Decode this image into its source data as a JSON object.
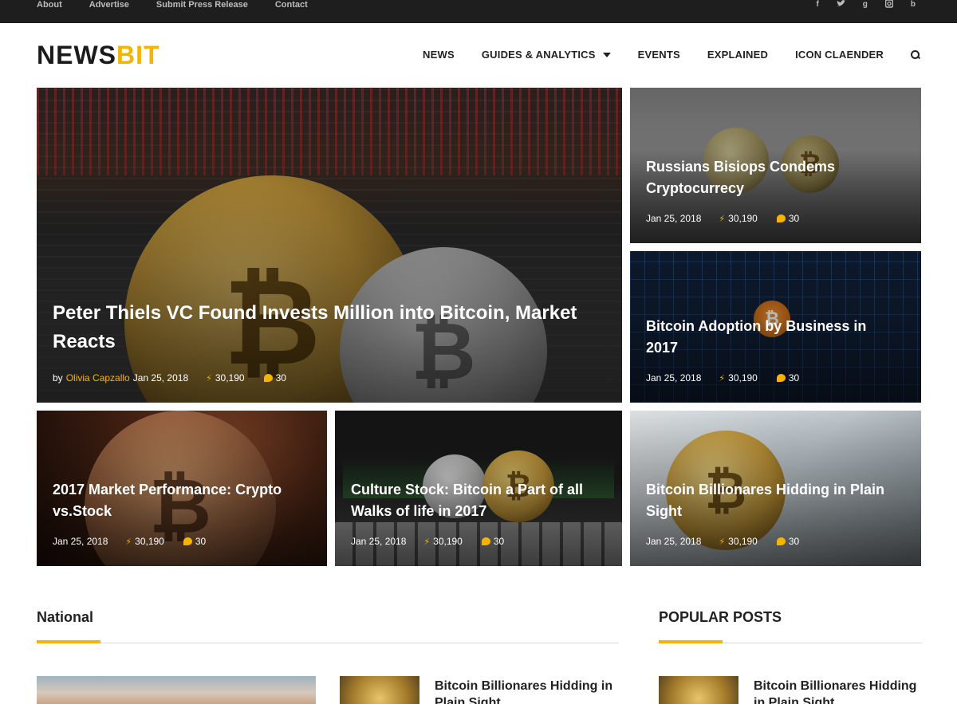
{
  "topbar": {
    "links": [
      "About",
      "Advertise",
      "Submit Press Release",
      "Contact"
    ],
    "social": [
      "f",
      "t",
      "g",
      "i",
      "b"
    ]
  },
  "logo": {
    "part1": "NEWS",
    "part2": "BIT"
  },
  "nav": {
    "items": [
      "NEWS",
      "GUIDES & ANALYTICS",
      "EVENTS",
      "EXPLAINED",
      "ICON CLAENDER"
    ]
  },
  "featured": {
    "title": "Peter Thiels VC Found Invests Million into Bitcoin, Market Reacts",
    "by": "by",
    "author": "Olivia Capzallo",
    "date": "Jan 25, 2018",
    "views": "30,190",
    "comments": "30"
  },
  "cards": [
    {
      "title": "Russians Bisiops Condems Cryptocurrecy",
      "date": "Jan 25, 2018",
      "views": "30,190",
      "comments": "30"
    },
    {
      "title": "Bitcoin Adoption by Business in 2017",
      "date": "Jan 25, 2018",
      "views": "30,190",
      "comments": "30"
    },
    {
      "title": "2017 Market Performance: Crypto vs.Stock",
      "date": "Jan 25, 2018",
      "views": "30,190",
      "comments": "30"
    },
    {
      "title": "Culture Stock: Bitcoin a Part of all Walks of life in 2017",
      "date": "Jan 25, 2018",
      "views": "30,190",
      "comments": "30"
    },
    {
      "title": "Bitcoin Billionares Hidding in Plain Sight",
      "date": "Jan 25, 2018",
      "views": "30,190",
      "comments": "30"
    }
  ],
  "sections": {
    "national": "National",
    "popular": "POPULAR POSTS"
  },
  "national_list": [
    {
      "title": "Bitcoin Billionares Hidding in Plain Sight"
    }
  ],
  "popular_list": [
    {
      "title": "Bitcoin Billionares Hidding in Plain Sight"
    }
  ],
  "colors": {
    "accent": "#f5b400",
    "topbar": "#1e1e1e"
  }
}
